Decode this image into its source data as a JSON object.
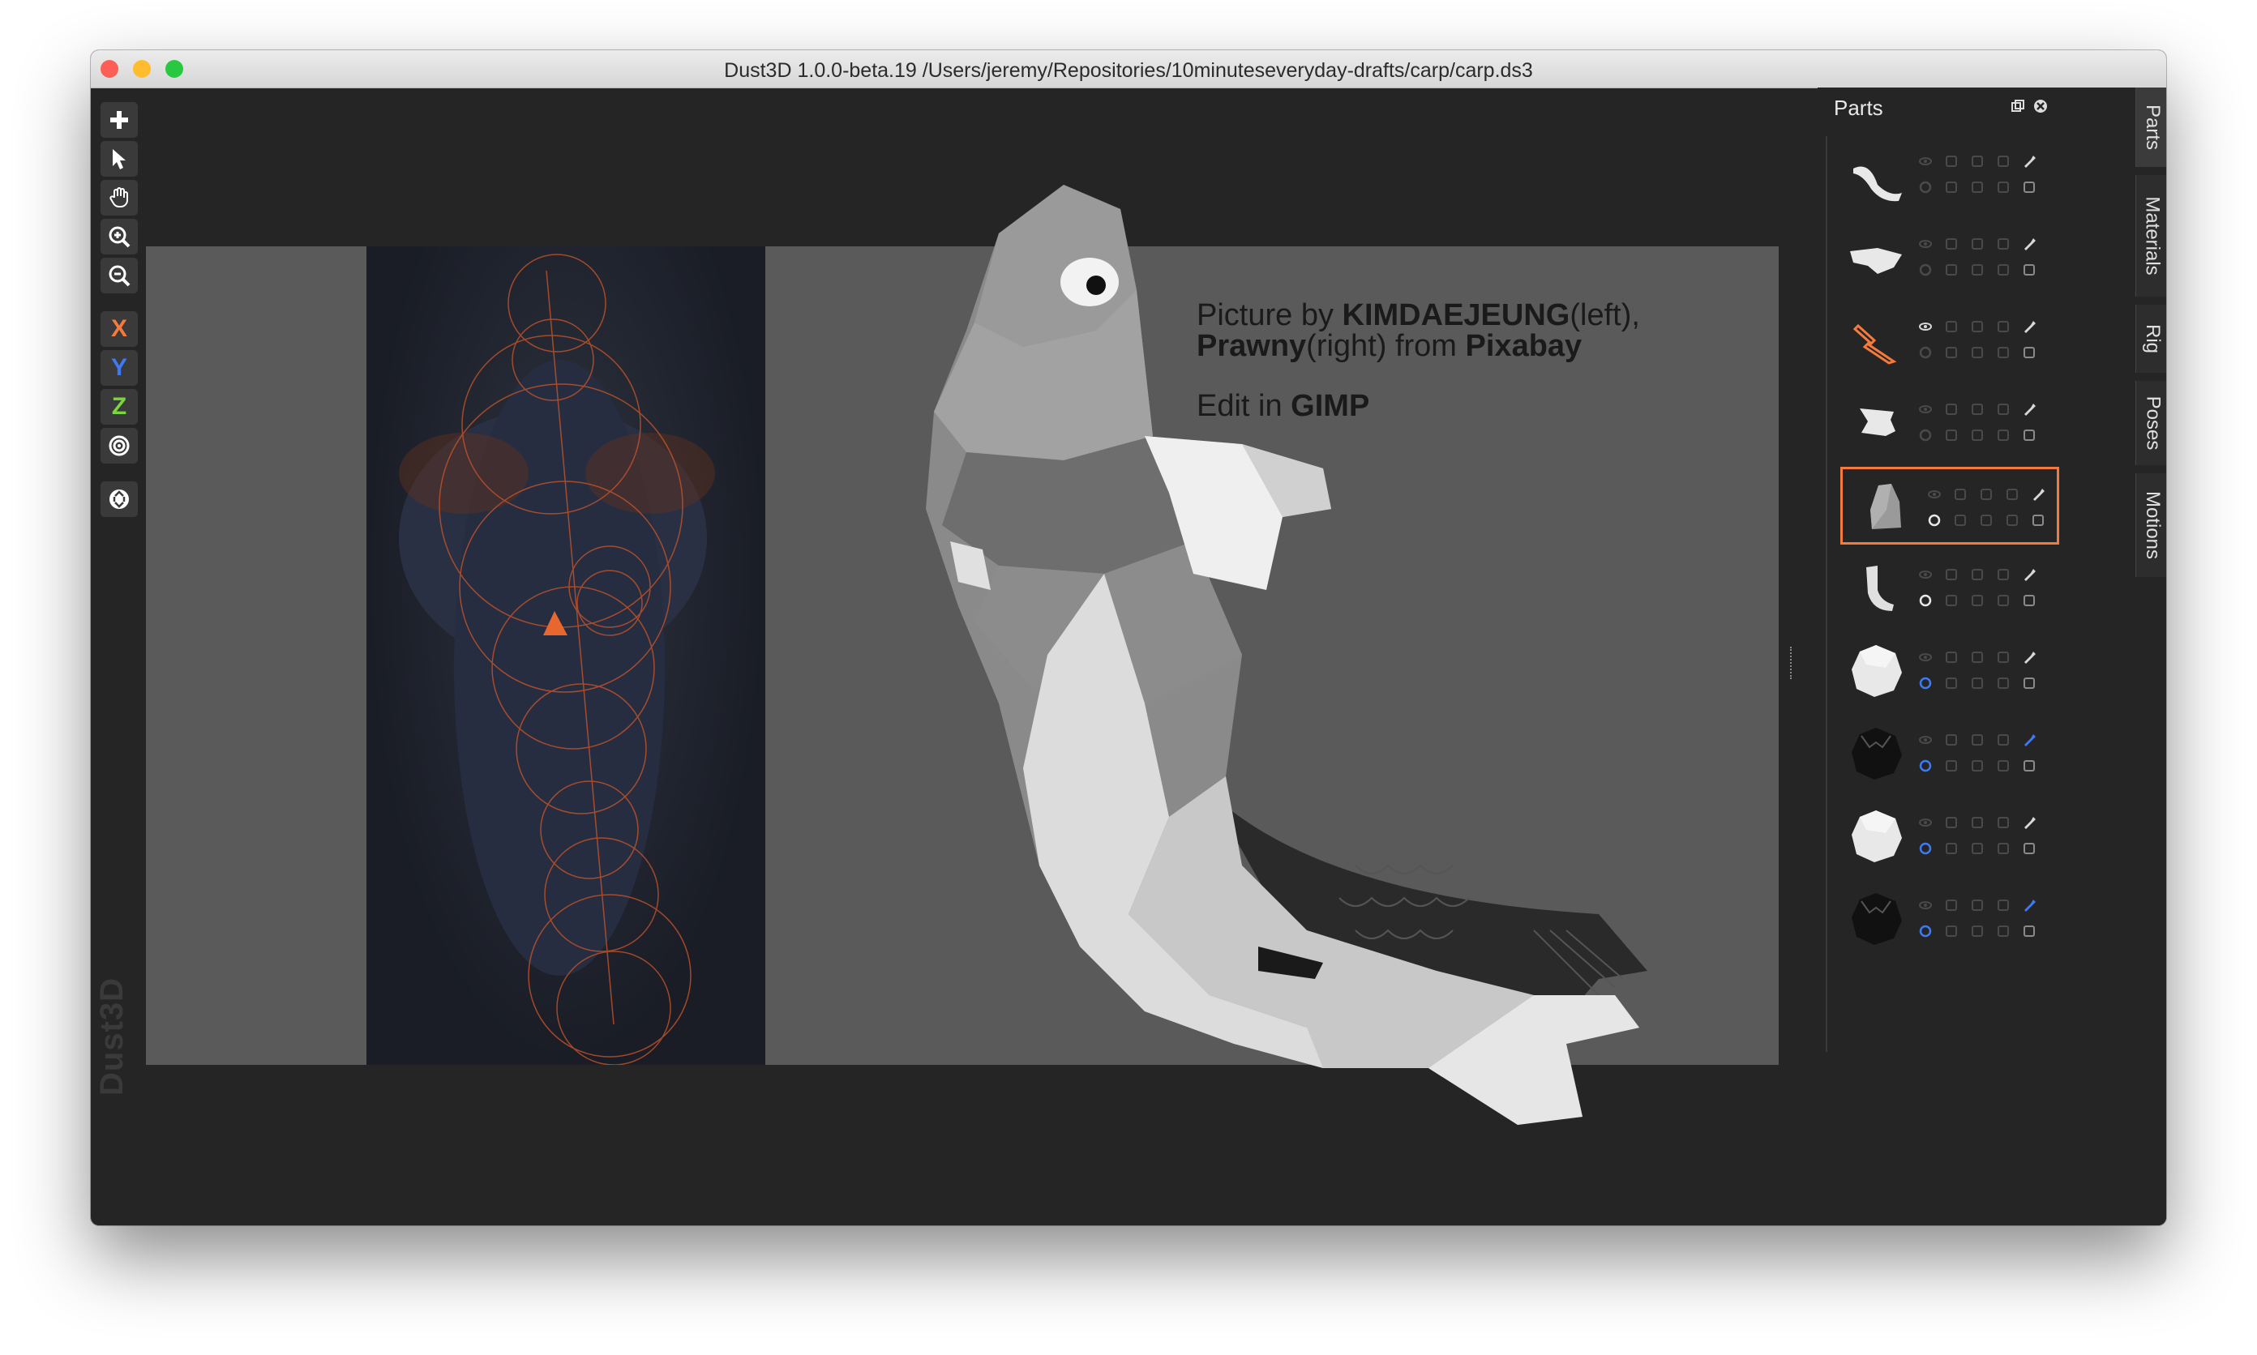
{
  "window": {
    "title": "Dust3D 1.0.0-beta.19 /Users/jeremy/Repositories/10minuteseveryday-drafts/carp/carp.ds3"
  },
  "toolbar": {
    "tools": [
      {
        "name": "add-icon"
      },
      {
        "name": "select-arrow-icon"
      },
      {
        "name": "hand-pan-icon"
      },
      {
        "name": "zoom-in-icon"
      },
      {
        "name": "zoom-out-icon"
      }
    ],
    "axes": [
      {
        "label": "X",
        "color": "#f47a3d"
      },
      {
        "label": "Y",
        "color": "#3d7af4"
      },
      {
        "label": "Z",
        "color": "#7ad63d"
      }
    ],
    "extra_tools": [
      {
        "name": "radial-target-icon"
      },
      {
        "name": "recycle-icon"
      }
    ]
  },
  "watermark": "Dust3D",
  "credit": {
    "line1_prefix": "Picture by ",
    "line1_name": "KIMDAEJEUNG",
    "line1_suffix": "(left),",
    "line2_name": "Prawny",
    "line2_mid": "(right) from ",
    "line2_site": "Pixabay",
    "line3_prefix": "Edit in ",
    "line3_app": "GIMP"
  },
  "parts_panel": {
    "title": "Parts",
    "parts": [
      {
        "thumb": "tail-curve",
        "selected": false,
        "accent": "#ffffff"
      },
      {
        "thumb": "fin-flat",
        "selected": false,
        "accent": "#ffffff"
      },
      {
        "thumb": "whisker-orange",
        "selected": false,
        "accent": "#f47a3d"
      },
      {
        "thumb": "pectoral-fin",
        "selected": false,
        "accent": "#ffffff"
      },
      {
        "thumb": "body-blob",
        "selected": true,
        "accent": "#ffffff"
      },
      {
        "thumb": "tail-hook",
        "selected": false,
        "accent": "#ffffff"
      },
      {
        "thumb": "round-white",
        "selected": false,
        "accent": "#3d7af4"
      },
      {
        "thumb": "round-black",
        "selected": false,
        "accent": "#3d7af4"
      },
      {
        "thumb": "round-white",
        "selected": false,
        "accent": "#3d7af4"
      },
      {
        "thumb": "round-black",
        "selected": false,
        "accent": "#3d7af4"
      }
    ]
  },
  "tabs": [
    "Parts",
    "Materials",
    "Rig",
    "Poses",
    "Motions"
  ],
  "colors": {
    "accent": "#f47a3d",
    "background": "#252525",
    "reference": "#5a5a5a"
  }
}
